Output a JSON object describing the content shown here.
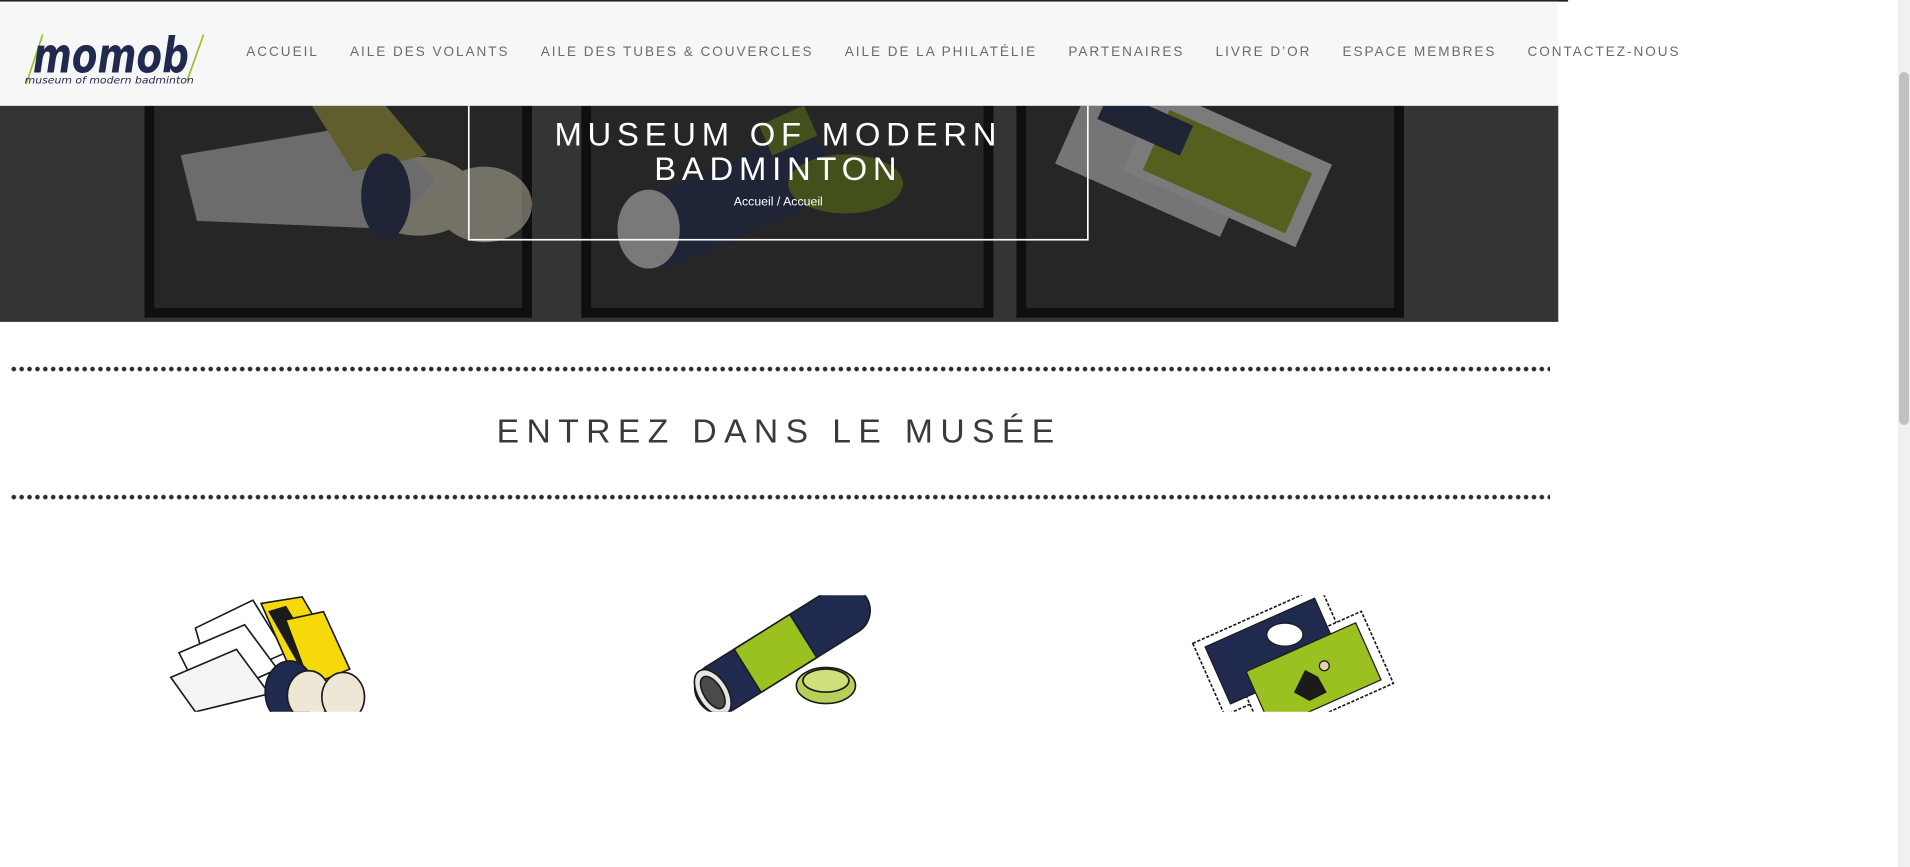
{
  "logo": {
    "wordmark": "momob",
    "tagline": "museum of modern badminton"
  },
  "nav": {
    "items": [
      "ACCUEIL",
      "AILE DES VOLANTS",
      "AILE DES TUBES & COUVERCLES",
      "AILE DE LA PHILATÉLIE",
      "PARTENAIRES",
      "LIVRE D’OR",
      "ESPACE MEMBRES",
      "CONTACTEZ-NOUS"
    ]
  },
  "hero": {
    "title": "MUSEUM OF MODERN BADMINTON",
    "breadcrumb": "Accueil / Accueil"
  },
  "section": {
    "title": "ENTREZ DANS LE MUSÉE"
  },
  "wings": [
    {
      "icon": "shuttlecock-icon"
    },
    {
      "icon": "shuttle-tube-icon"
    },
    {
      "icon": "stamps-icon"
    }
  ],
  "colors": {
    "nav_text": "#6b6b6b",
    "brand_navy": "#1f2a4e",
    "brand_lime": "#9ac11f",
    "hero_overlay": "#3a3a3a",
    "dots": "#2d2d2d"
  }
}
